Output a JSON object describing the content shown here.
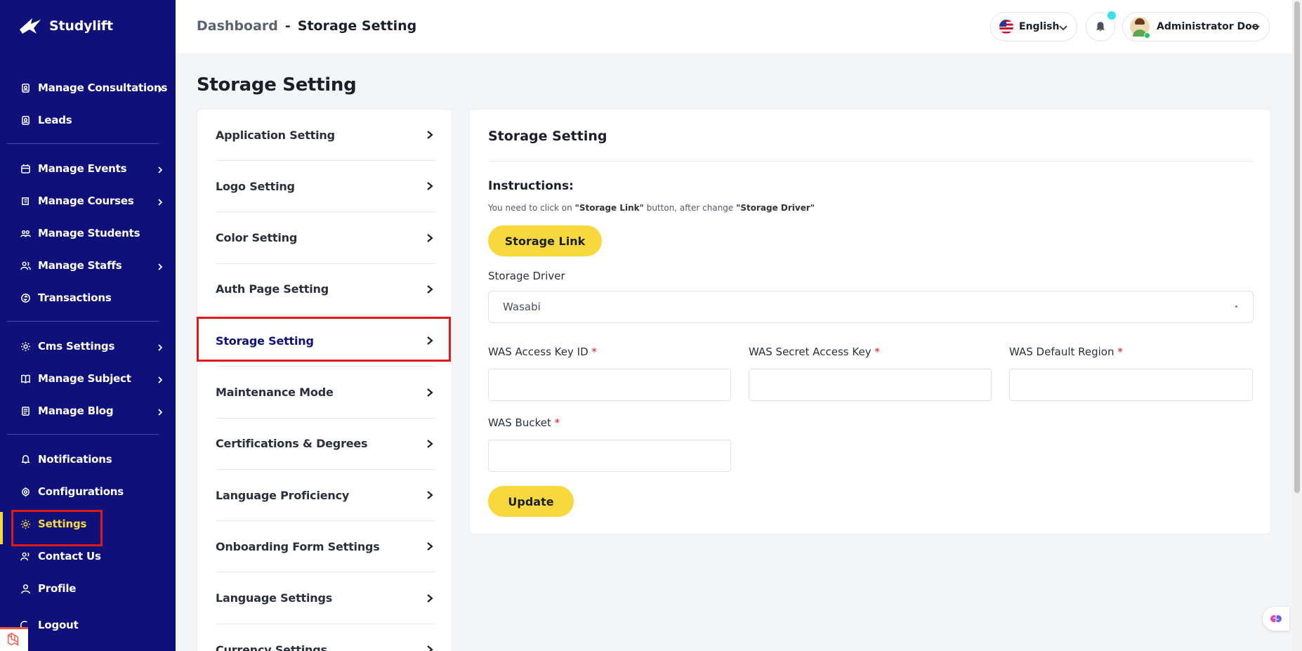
{
  "brand": {
    "name": "Studylift"
  },
  "sidebar": {
    "groups": [
      [
        {
          "label": "Manage Consultations",
          "icon": "consultation-icon",
          "has_children": true
        },
        {
          "label": "Leads",
          "icon": "leads-icon",
          "has_children": false
        }
      ],
      [
        {
          "label": "Manage Events",
          "icon": "calendar-icon",
          "has_children": true
        },
        {
          "label": "Manage Courses",
          "icon": "courses-icon",
          "has_children": true
        },
        {
          "label": "Manage Students",
          "icon": "students-icon",
          "has_children": false
        },
        {
          "label": "Manage Staffs",
          "icon": "staffs-icon",
          "has_children": true
        },
        {
          "label": "Transactions",
          "icon": "transactions-icon",
          "has_children": false
        }
      ],
      [
        {
          "label": "Cms Settings",
          "icon": "gear-icon",
          "has_children": true
        },
        {
          "label": "Manage Subject",
          "icon": "book-icon",
          "has_children": true
        },
        {
          "label": "Manage Blog",
          "icon": "blog-icon",
          "has_children": true
        }
      ],
      [
        {
          "label": "Notifications",
          "icon": "bell-icon",
          "has_children": false
        },
        {
          "label": "Configurations",
          "icon": "configurations-icon",
          "has_children": false
        },
        {
          "label": "Settings",
          "icon": "gear-icon",
          "has_children": false,
          "active": true
        },
        {
          "label": "Contact Us",
          "icon": "contact-icon",
          "has_children": false
        },
        {
          "label": "Profile",
          "icon": "user-icon",
          "has_children": false
        },
        {
          "label": "Logout",
          "icon": "logout-icon",
          "has_children": false
        }
      ]
    ]
  },
  "header": {
    "breadcrumb_root": "Dashboard",
    "breadcrumb_sep": "-",
    "breadcrumb_current": "Storage Setting",
    "language": "English",
    "user_name": "Administrator Doe"
  },
  "page": {
    "title": "Storage Setting"
  },
  "settings_menu": [
    {
      "label": "Application Setting"
    },
    {
      "label": "Logo Setting"
    },
    {
      "label": "Color Setting"
    },
    {
      "label": "Auth Page Setting"
    },
    {
      "label": "Storage Setting",
      "active": true
    },
    {
      "label": "Maintenance Mode"
    },
    {
      "label": "Certifications & Degrees"
    },
    {
      "label": "Language Proficiency"
    },
    {
      "label": "Onboarding Form Settings"
    },
    {
      "label": "Language Settings"
    },
    {
      "label": "Currency Settings"
    }
  ],
  "form": {
    "card_title": "Storage Setting",
    "instructions_title": "Instructions:",
    "instructions_pre": "You need to click on ",
    "instructions_link_word": "\"Storage Link\"",
    "instructions_mid": " button, after change ",
    "instructions_driver_word": "\"Storage Driver\"",
    "storage_link_button": "Storage Link",
    "storage_driver_label": "Storage Driver",
    "storage_driver_value": "Wasabi",
    "fields": {
      "access_key_label": "WAS Access Key ID",
      "secret_key_label": "WAS Secret Access Key",
      "region_label": "WAS Default Region",
      "bucket_label": "WAS Bucket",
      "required_mark": "*"
    },
    "update_button": "Update"
  },
  "colors": {
    "sidebar_bg": "#10107a",
    "accent_yellow": "#f7d93e",
    "highlight_red": "#e01818"
  }
}
